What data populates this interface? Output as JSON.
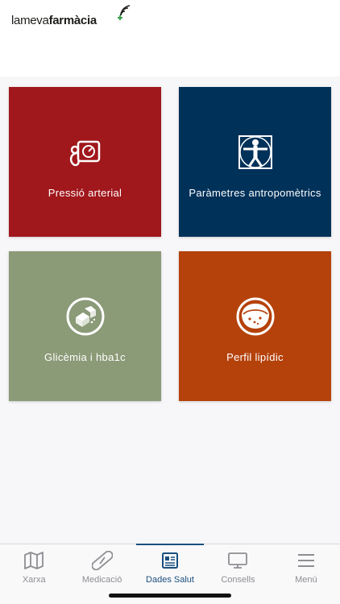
{
  "header": {
    "logo_light": "lameva",
    "logo_bold": "farmàcia"
  },
  "tiles": [
    {
      "label": "Pressió arterial",
      "color": "#a0171c",
      "icon": "blood-pressure-icon"
    },
    {
      "label": "Paràmetres antropomètrics",
      "color": "#003159",
      "icon": "vitruvian-man-icon"
    },
    {
      "label": "Glicèmia i hba1c",
      "color": "#8b9a77",
      "icon": "sugar-cubes-icon"
    },
    {
      "label": "Perfil lipídic",
      "color": "#b5420b",
      "icon": "lipid-icon"
    }
  ],
  "tabbar": {
    "items": [
      {
        "label": "Xarxa",
        "icon": "map-icon",
        "active": false
      },
      {
        "label": "Medicació",
        "icon": "pill-icon",
        "active": false
      },
      {
        "label": "Dades Salut",
        "icon": "health-data-icon",
        "active": true
      },
      {
        "label": "Consells",
        "icon": "monitor-icon",
        "active": false
      },
      {
        "label": "Menú",
        "icon": "menu-icon",
        "active": false
      }
    ]
  },
  "colors": {
    "accent": "#1b4f7e",
    "inactive": "#8e8e93"
  }
}
